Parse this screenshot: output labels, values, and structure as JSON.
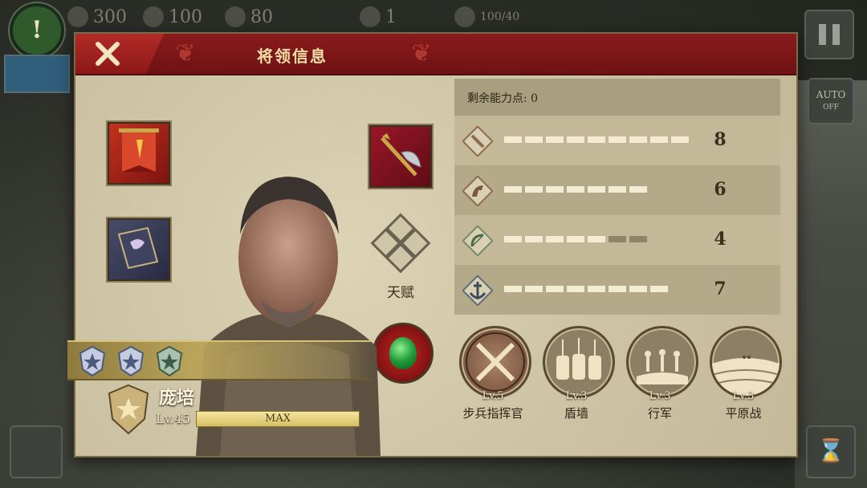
{
  "topbar": {
    "resources": [
      {
        "icon": "gold-coin-icon",
        "value": "300"
      },
      {
        "icon": "hammer-icon",
        "value": "100"
      },
      {
        "icon": "scroll-icon",
        "value": "80"
      }
    ],
    "army_count": "1",
    "troops": "100/40"
  },
  "auto_button": {
    "label": "AUTO",
    "state": "OFF"
  },
  "panel": {
    "title": "将领信息",
    "talent_label": "天赋"
  },
  "general": {
    "name": "庞培",
    "level": "Lv.45",
    "xp_label": "MAX"
  },
  "stats": {
    "points_label": "剩余能力点: 0",
    "rows": [
      {
        "icon": "sword-icon",
        "value": "8",
        "filled": 9,
        "total": 9
      },
      {
        "icon": "horse-icon",
        "value": "6",
        "filled": 7,
        "total": 7
      },
      {
        "icon": "bow-icon",
        "value": "4",
        "filled": 5,
        "total": 7
      },
      {
        "icon": "anchor-icon",
        "value": "7",
        "filled": 8,
        "total": 8
      }
    ]
  },
  "skills": [
    {
      "level": "Lv.5",
      "name": "步兵指挥官"
    },
    {
      "level": "Lv.3",
      "name": "盾墙"
    },
    {
      "level": "Lv.3",
      "name": "行军"
    },
    {
      "level": "Lv.3",
      "name": "平原战"
    }
  ],
  "colors": {
    "header": "#8a1b1c",
    "panel": "#cfc4a6",
    "accent_gold": "#d6bf62"
  }
}
